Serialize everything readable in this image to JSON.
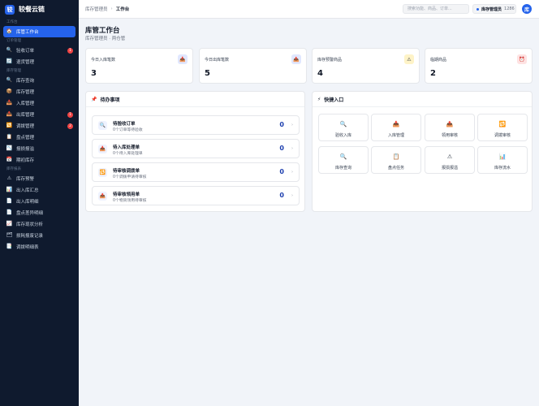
{
  "brand": {
    "logo": "较",
    "name": "较餐云链"
  },
  "sidebar": {
    "sections": [
      {
        "label": "工作台"
      },
      {
        "label": "订单管理"
      },
      {
        "label": "库存管理"
      },
      {
        "label": "库存报表"
      }
    ],
    "items": [
      {
        "label": "库管工作台",
        "icon": "home-icon",
        "glyph": "🏠",
        "active": true
      },
      {
        "label": "验收订单",
        "icon": "search-icon",
        "glyph": "🔍",
        "badge": "1"
      },
      {
        "label": "退货管理",
        "icon": "return-icon",
        "glyph": "🔄"
      },
      {
        "label": "库存查询",
        "icon": "search-icon",
        "glyph": "🔍"
      },
      {
        "label": "库存管理",
        "icon": "box-icon",
        "glyph": "📦"
      },
      {
        "label": "入库管理",
        "icon": "inbound-icon",
        "glyph": "📥"
      },
      {
        "label": "出库管理",
        "icon": "outbound-icon",
        "glyph": "📤",
        "badge": "1"
      },
      {
        "label": "调拨管理",
        "icon": "transfer-icon",
        "glyph": "🔁",
        "badge": "2"
      },
      {
        "label": "盘点管理",
        "icon": "clipboard-icon",
        "glyph": "📋"
      },
      {
        "label": "报损报溢",
        "icon": "chart-icon",
        "glyph": "📉"
      },
      {
        "label": "期初库存",
        "icon": "calendar-icon",
        "glyph": "📅"
      },
      {
        "label": "库存预警",
        "icon": "warning-icon",
        "glyph": "⚠"
      },
      {
        "label": "出入库汇总",
        "icon": "summary-icon",
        "glyph": "📊"
      },
      {
        "label": "出入库明细",
        "icon": "document-icon",
        "glyph": "📄"
      },
      {
        "label": "盘点差异明细",
        "icon": "document-icon",
        "glyph": "📄"
      },
      {
        "label": "库存现状分析",
        "icon": "analysis-icon",
        "glyph": "📈"
      },
      {
        "label": "损耗报废记录",
        "icon": "records-icon",
        "glyph": "🗂"
      },
      {
        "label": "调拨明细表",
        "icon": "table-icon",
        "glyph": "📑"
      }
    ]
  },
  "topbar": {
    "breadcrumb_parent": "库存管理员",
    "breadcrumb_sep": "›",
    "breadcrumb_current": "工作台",
    "search_placeholder": "搜索功能、商品、订单...",
    "role_name": "库存管理员",
    "role_id": "1286",
    "avatar": "库"
  },
  "page": {
    "title": "库管工作台",
    "subtitle": "库存管理员 · 两仓管"
  },
  "stats": [
    {
      "label": "今日入库笔数",
      "value": "3",
      "icon": "inbound-icon",
      "glyph": "📥",
      "color": "#e0e7ff"
    },
    {
      "label": "今日出库笔数",
      "value": "5",
      "icon": "outbound-icon",
      "glyph": "📤",
      "color": "#e0e7ff"
    },
    {
      "label": "库存预警商品",
      "value": "4",
      "icon": "warning-icon",
      "glyph": "⚠",
      "color": "#fef3c7"
    },
    {
      "label": "临期商品",
      "value": "2",
      "icon": "alarm-icon",
      "glyph": "⏰",
      "color": "#fee2e2"
    }
  ],
  "todo_panel": {
    "title": "待办事项",
    "icon": "pin-icon",
    "glyph": "📌",
    "items": [
      {
        "title": "待验收订单",
        "sub": "0个订单等待验收",
        "count": "0",
        "icon": "search-icon",
        "glyph": "🔍"
      },
      {
        "title": "待入库处理单",
        "sub": "0个待入库处理单",
        "count": "0",
        "icon": "inbound-icon",
        "glyph": "📥"
      },
      {
        "title": "待审核调拨单",
        "sub": "0个调拨申请待审核",
        "count": "0",
        "icon": "transfer-icon",
        "glyph": "🔁"
      },
      {
        "title": "待审核领用单",
        "sub": "0个物资领用待审核",
        "count": "0",
        "icon": "outbound-icon",
        "glyph": "📤"
      }
    ],
    "arrow": "›"
  },
  "quick_panel": {
    "title": "快捷入口",
    "icon": "lightning-icon",
    "glyph": "⚡",
    "items": [
      {
        "label": "验收入库",
        "icon": "search-icon",
        "glyph": "🔍"
      },
      {
        "label": "入库管理",
        "icon": "inbound-icon",
        "glyph": "📥"
      },
      {
        "label": "领用审核",
        "icon": "outbound-icon",
        "glyph": "📤"
      },
      {
        "label": "调拨审核",
        "icon": "transfer-icon",
        "glyph": "🔁"
      },
      {
        "label": "库存查询",
        "icon": "search-icon",
        "glyph": "🔍"
      },
      {
        "label": "盘点任务",
        "icon": "clipboard-icon",
        "glyph": "📋"
      },
      {
        "label": "报损报溢",
        "icon": "warning-icon",
        "glyph": "⚠"
      },
      {
        "label": "库存流水",
        "icon": "chart-icon",
        "glyph": "📊"
      }
    ]
  }
}
